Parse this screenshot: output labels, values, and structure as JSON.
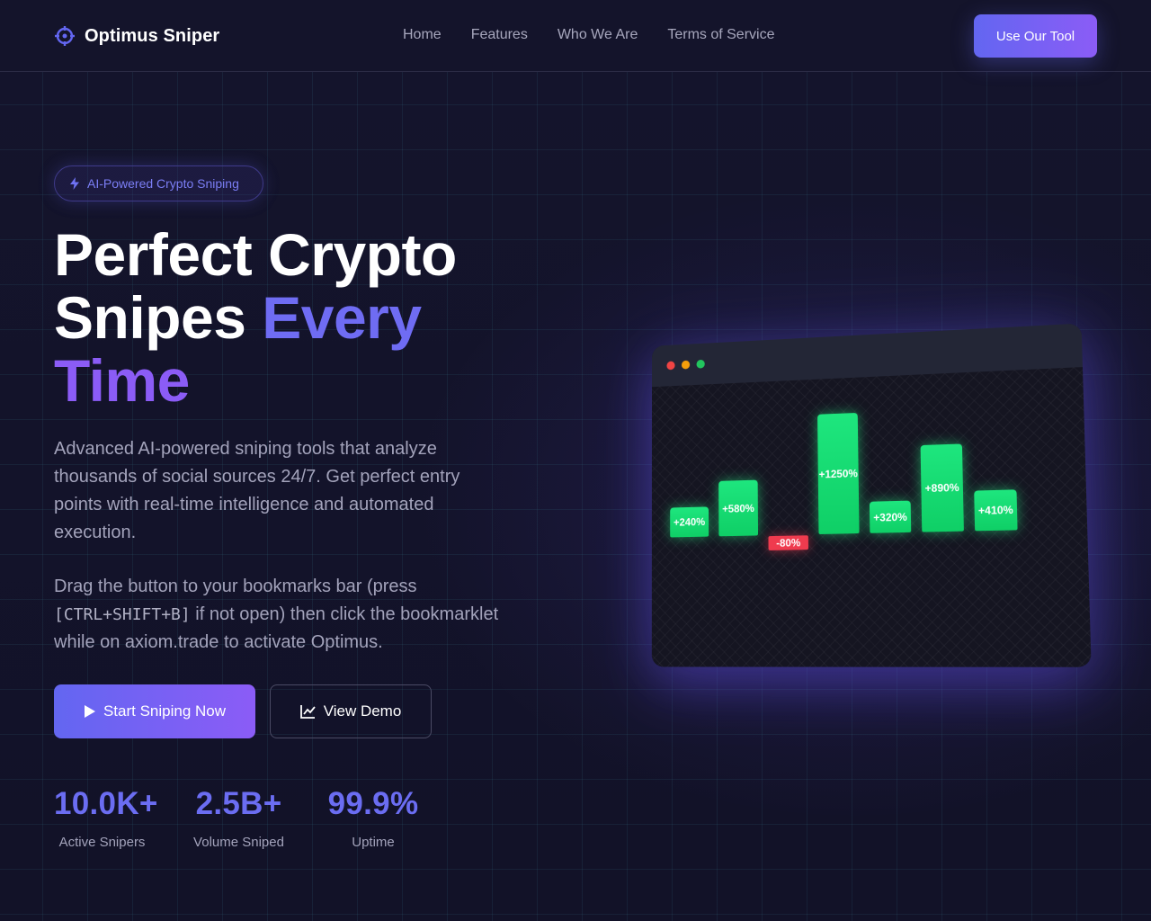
{
  "nav": {
    "brand": "Optimus Sniper",
    "brand_icon": "crosshair-icon",
    "links": [
      "Home",
      "Features",
      "Who We Are",
      "Terms of Service"
    ],
    "cta": "Use Our Tool"
  },
  "hero": {
    "badge": "AI-Powered Crypto Sniping",
    "badge_icon": "lightning-icon",
    "headline_line1": "Perfect Crypto",
    "headline_line2_plain": "Snipes",
    "headline_line2_accent": "Every",
    "headline_line3_accent": "Time",
    "description": "Advanced AI-powered sniping tools that analyze thousands of social sources 24/7. Get perfect entry points with real-time intelligence and automated execution.",
    "instructions_before": "Drag the button to your bookmarks bar (press ",
    "instructions_kbd": "[CTRL+SHIFT+B]",
    "instructions_after": " if not open) then click the bookmarklet while on axiom.trade to activate Optimus.",
    "primary_button": "Start Sniping Now",
    "primary_icon": "play-icon",
    "secondary_button": "View Demo",
    "secondary_icon": "chart-line-icon"
  },
  "stats": [
    {
      "value": "10.0K+",
      "label": "Active Snipers"
    },
    {
      "value": "2.5B+",
      "label": "Volume Sniped"
    },
    {
      "value": "99.9%",
      "label": "Uptime"
    }
  ],
  "mockup": {
    "window_dots": [
      "#ef4444",
      "#f59e0b",
      "#22c55e"
    ]
  },
  "chart_data": {
    "type": "bar",
    "categories": [
      "1",
      "2",
      "3",
      "4",
      "5",
      "6",
      "7"
    ],
    "values": [
      240,
      580,
      -80,
      1250,
      320,
      890,
      410
    ],
    "labels": [
      "+240%",
      "+580%",
      "-80%",
      "+1250%",
      "+320%",
      "+890%",
      "+410%"
    ],
    "colors": {
      "positive": "#1ee67e",
      "negative": "#ef3b4e"
    }
  },
  "colors": {
    "accent": "#6366f1",
    "accent_purple": "#8b5cf6",
    "background": "#12122a"
  }
}
